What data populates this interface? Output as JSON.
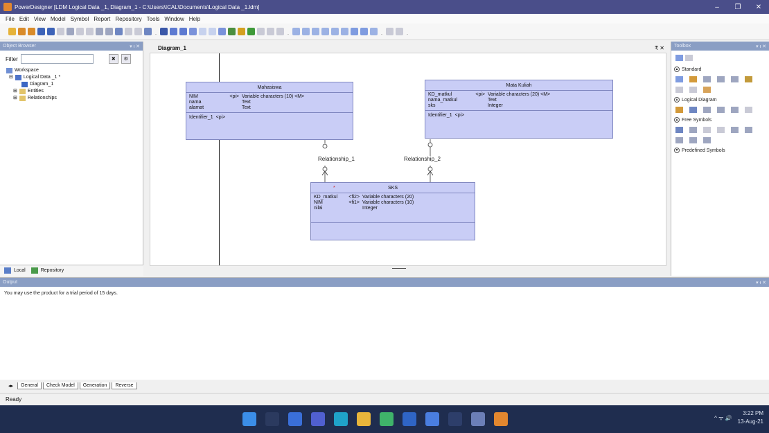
{
  "window": {
    "title": "PowerDesigner [LDM Logical Data _1, Diagram_1 - C:\\Users\\ICAL\\Documents\\Logical Data _1.ldm]",
    "minimize": "‒",
    "maximize": "❐",
    "close": "✕"
  },
  "menu": [
    "File",
    "Edit",
    "View",
    "Model",
    "Symbol",
    "Report",
    "Repository",
    "Tools",
    "Window",
    "Help"
  ],
  "object_browser": {
    "title": "Object Browser",
    "controls": "▾ ᵻ ✕",
    "filter_label": "Filter",
    "filter_value": "",
    "tree": [
      {
        "label": "Workspace",
        "indent": 0
      },
      {
        "label": "Logical Data _1 *",
        "indent": 1
      },
      {
        "label": "Diagram_1",
        "indent": 2
      },
      {
        "label": "Entities",
        "indent": 2
      },
      {
        "label": "Relationships",
        "indent": 2
      }
    ],
    "tabs": [
      "Local",
      "Repository"
    ]
  },
  "diagram": {
    "tab": "Diagram_1",
    "controls": "₹ ✕",
    "entities": {
      "mahasiswa": {
        "name": "Mahasiswa",
        "attributes": [
          {
            "name": "NIM",
            "key": "<pi>",
            "type": "Variable characters (10) <M>"
          },
          {
            "name": "nama",
            "key": "",
            "type": "Text"
          },
          {
            "name": "alamat",
            "key": "",
            "type": "Text"
          }
        ],
        "identifier": {
          "name": "Identifier_1",
          "tag": "<pi>"
        }
      },
      "mata_kuliah": {
        "name": "Mata Kuliah",
        "attributes": [
          {
            "name": "KD_matkul",
            "key": "<pi>",
            "type": "Variable characters (20) <M>"
          },
          {
            "name": "nama_matkul",
            "key": "",
            "type": "Text"
          },
          {
            "name": "sks",
            "key": "",
            "type": "Integer"
          }
        ],
        "identifier": {
          "name": "Identifier_1",
          "tag": "<pi>"
        }
      },
      "sks": {
        "name": "SKS",
        "marker": "*",
        "attributes": [
          {
            "name": "KD_matkul",
            "key": "<fi2>",
            "type": "Variable characters (20)"
          },
          {
            "name": "NIM",
            "key": "<fi1>",
            "type": "Variable characters (10)"
          },
          {
            "name": "nilai",
            "key": "",
            "type": "Integer"
          }
        ]
      }
    },
    "relationships": [
      "Relationship_1",
      "Relationship_2"
    ]
  },
  "toolbox": {
    "title": "Toolbox",
    "controls": "▾ ᵻ ✕",
    "sections": [
      "Standard",
      "Logical Diagram",
      "Free Symbols",
      "Predefined Symbols"
    ]
  },
  "output": {
    "title": "Output",
    "controls": "▾ ᵻ ✕",
    "message": "You may use the product for a trial period of 15 days.",
    "tabs": [
      "General",
      "Check Model",
      "Generation",
      "Reverse"
    ]
  },
  "status": {
    "text": "Ready"
  },
  "taskbar": {
    "time": "3:22 PM",
    "date": "13-Aug-21",
    "tray": "^ ᯤ 🔊"
  },
  "colors": {
    "entity_fill": "#c9cdf6",
    "entity_border": "#7f86bf",
    "title_bar": "#4a4e8a",
    "panel_header": "#8a9ec4",
    "taskbar": "#1f2d4f"
  }
}
